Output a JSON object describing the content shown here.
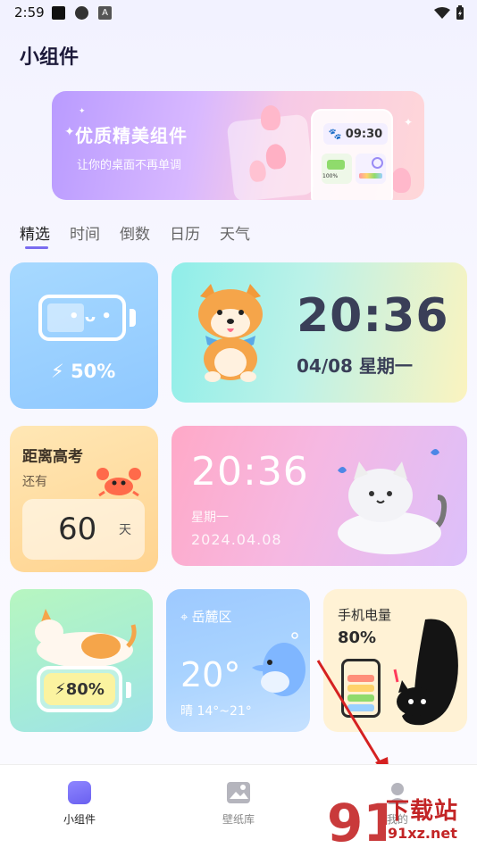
{
  "status_bar": {
    "time": "2:59"
  },
  "page_title": "小组件",
  "banner": {
    "title": "优质精美组件",
    "subtitle": "让你的桌面不再单调",
    "clock_time": "09:30",
    "battery_text": "100%"
  },
  "tabs": [
    {
      "label": "精选",
      "active": true
    },
    {
      "label": "时间",
      "active": false
    },
    {
      "label": "倒数",
      "active": false
    },
    {
      "label": "日历",
      "active": false
    },
    {
      "label": "天气",
      "active": false
    }
  ],
  "widgets": {
    "battery": {
      "percent_label": "50%",
      "level": 0.5
    },
    "doge_clock": {
      "time": "20:36",
      "date": "04/08 星期一"
    },
    "exam_countdown": {
      "title": "距离高考",
      "sub": "还有",
      "days": "60",
      "unit": "天"
    },
    "cat_clock": {
      "time": "20:36",
      "weekday": "星期一",
      "date": "2024.04.08"
    },
    "cat_battery": {
      "percent_label": "80%",
      "level": 0.8
    },
    "weather": {
      "location": "岳麓区",
      "temp": "20°",
      "range": "晴 14°~21°"
    },
    "phone_power": {
      "title": "手机电量",
      "percent": "80%"
    }
  },
  "bottom_nav": [
    {
      "label": "小组件",
      "active": true
    },
    {
      "label": "壁纸库",
      "active": false
    },
    {
      "label": "我的",
      "active": false
    }
  ],
  "watermark": {
    "text1": "下载站",
    "text2": "91xz.net",
    "logo": "91"
  },
  "colors": {
    "accent": "#7a6cf0",
    "watermark_red": "#c32526"
  }
}
